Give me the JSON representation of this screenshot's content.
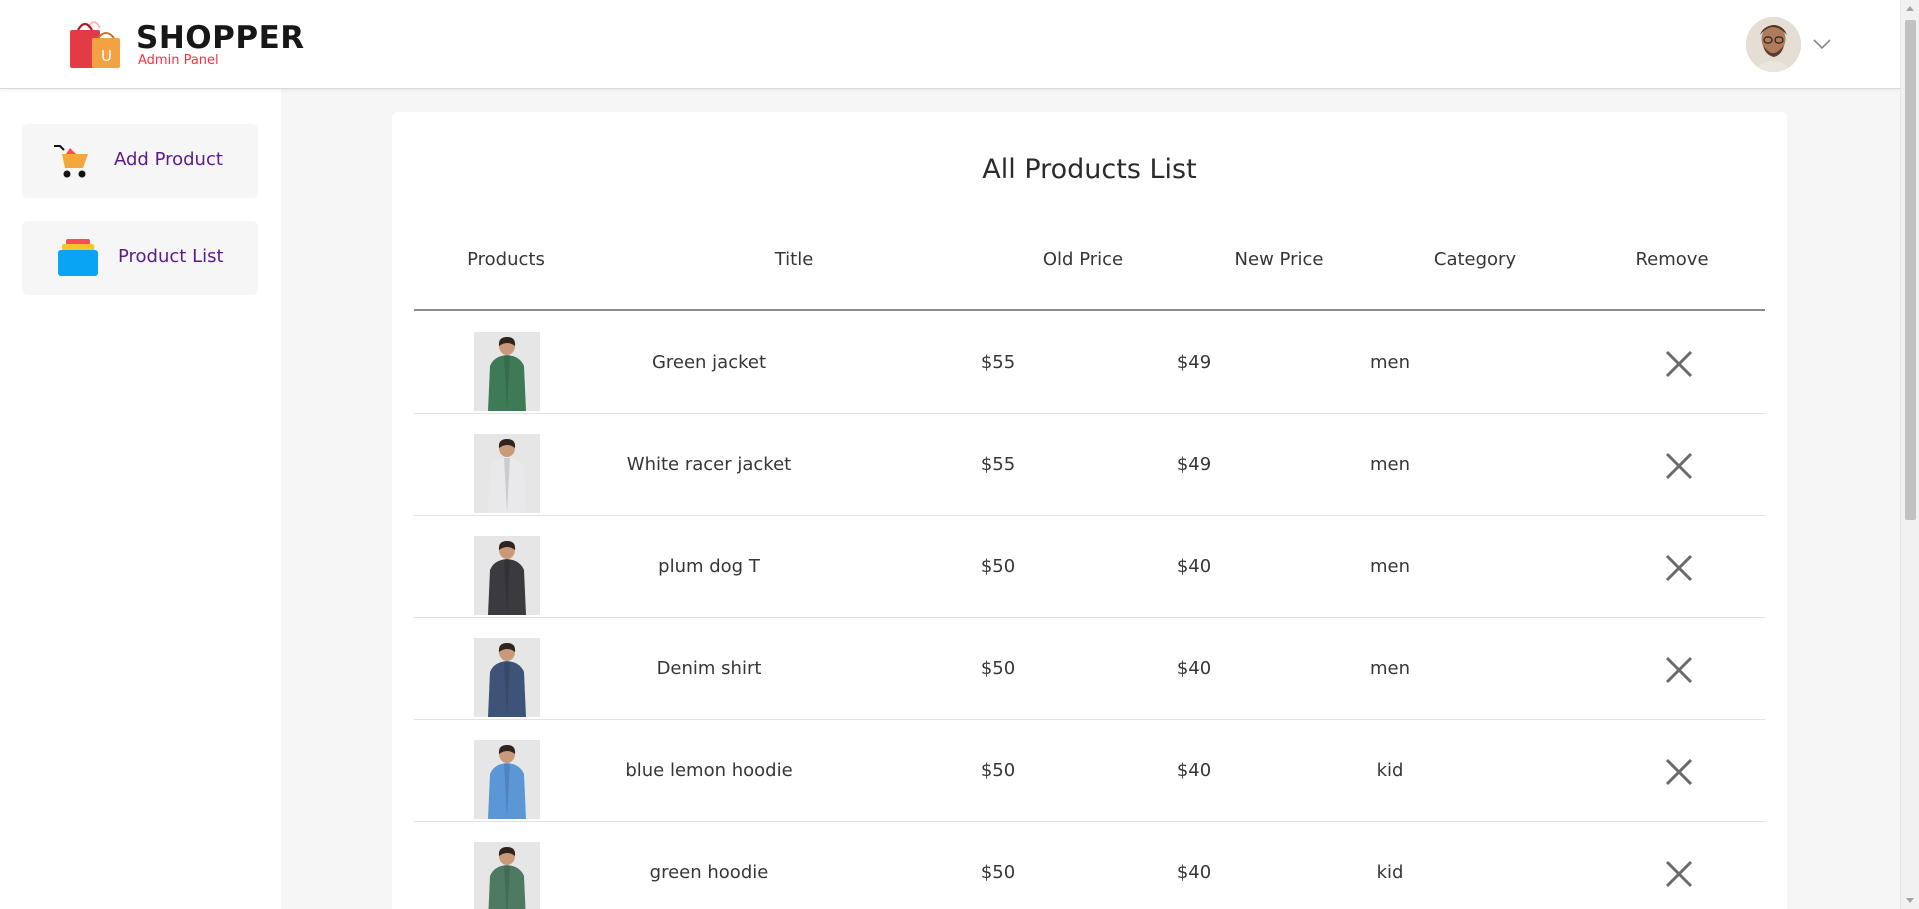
{
  "header": {
    "brand_name": "SHOPPER",
    "brand_sub": "Admin Panel",
    "logo_letter": "U"
  },
  "sidebar": {
    "items": [
      {
        "label": "Add Product",
        "icon": "cart-icon"
      },
      {
        "label": "Product List",
        "icon": "stack-icon"
      }
    ]
  },
  "main": {
    "title": "All Products List",
    "columns": [
      "Products",
      "Title",
      "Old Price",
      "New Price",
      "Category",
      "Remove"
    ],
    "rows": [
      {
        "title": "Green jacket",
        "old_price": "$55",
        "new_price": "$49",
        "category": "men",
        "thumb_color": "#3f7a56"
      },
      {
        "title": "White racer jacket",
        "old_price": "$55",
        "new_price": "$49",
        "category": "men",
        "thumb_color": "#e9e9ec"
      },
      {
        "title": "plum dog T",
        "old_price": "$50",
        "new_price": "$40",
        "category": "men",
        "thumb_color": "#3a3a3f"
      },
      {
        "title": "Denim shirt",
        "old_price": "$50",
        "new_price": "$40",
        "category": "men",
        "thumb_color": "#3d5478"
      },
      {
        "title": "blue lemon hoodie",
        "old_price": "$50",
        "new_price": "$40",
        "category": "kid",
        "thumb_color": "#5b97d6"
      },
      {
        "title": "green hoodie",
        "old_price": "$50",
        "new_price": "$40",
        "category": "kid",
        "thumb_color": "#4e7a61"
      }
    ]
  },
  "colors": {
    "accent": "#5a1a8c",
    "brand_sub": "#ff2f3f",
    "panel_bg": "#f6f6f6"
  }
}
